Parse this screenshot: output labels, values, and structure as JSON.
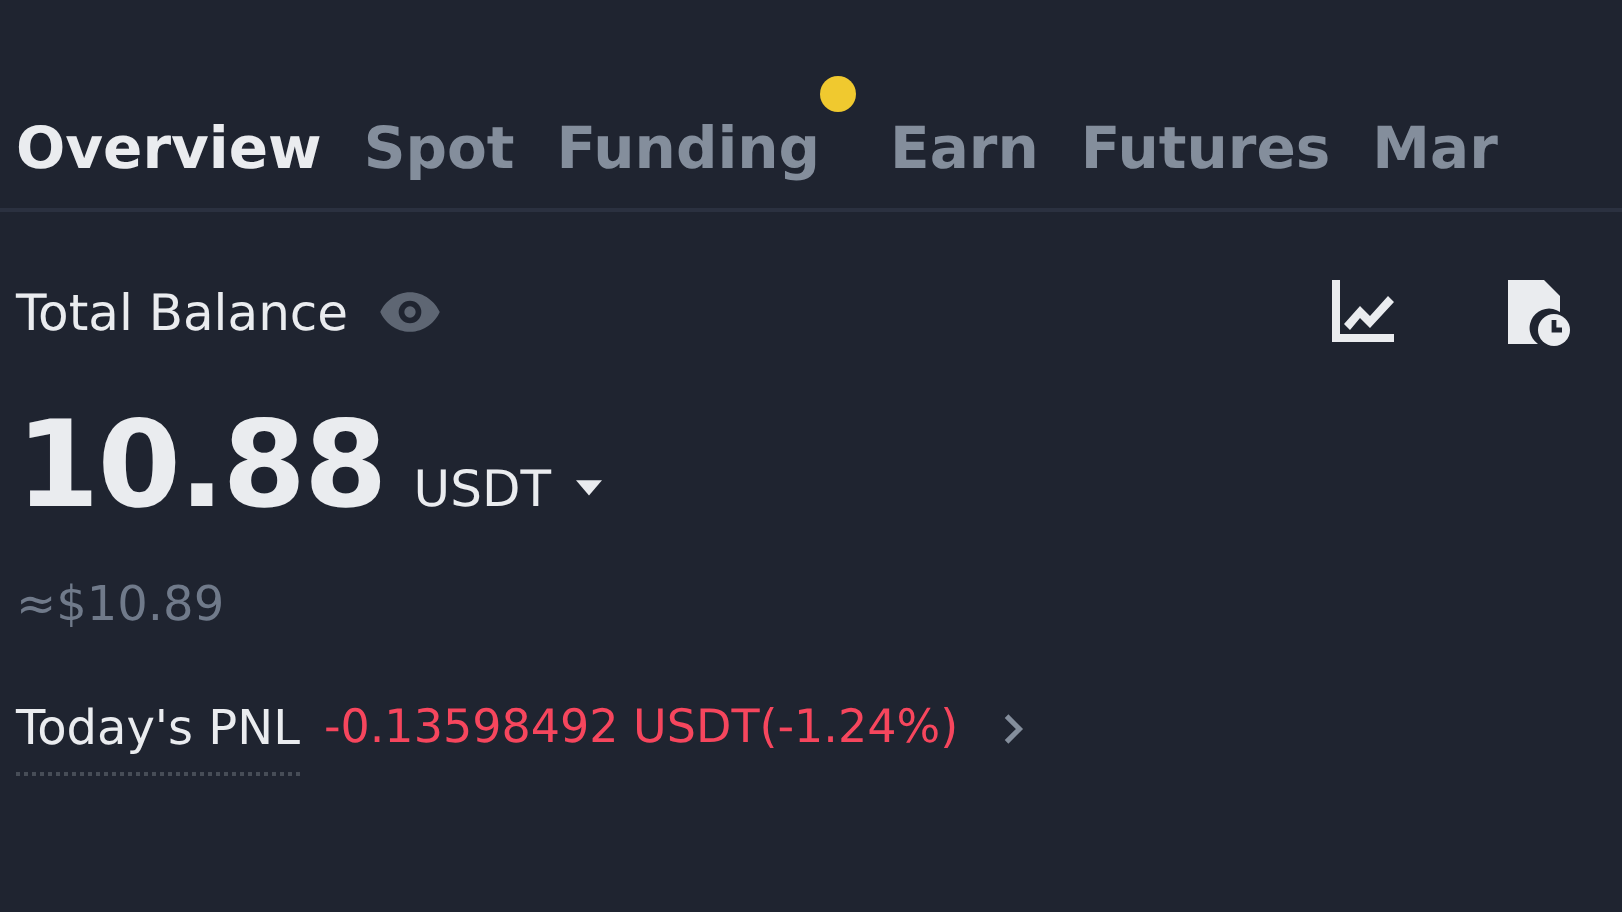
{
  "tabs": [
    {
      "label": "Overview",
      "selected": true,
      "badge": false
    },
    {
      "label": "Spot",
      "selected": false,
      "badge": false
    },
    {
      "label": "Funding",
      "selected": false,
      "badge": true
    },
    {
      "label": "Earn",
      "selected": false,
      "badge": false
    },
    {
      "label": "Futures",
      "selected": false,
      "badge": false
    },
    {
      "label": "Mar",
      "selected": false,
      "badge": false
    }
  ],
  "balance": {
    "label": "Total Balance",
    "amount": "10.88",
    "currency": "USDT",
    "fiat": "≈$10.89"
  },
  "pnl": {
    "label": "Today's PNL",
    "value": "-0.13598492 USDT(-1.24%)"
  }
}
